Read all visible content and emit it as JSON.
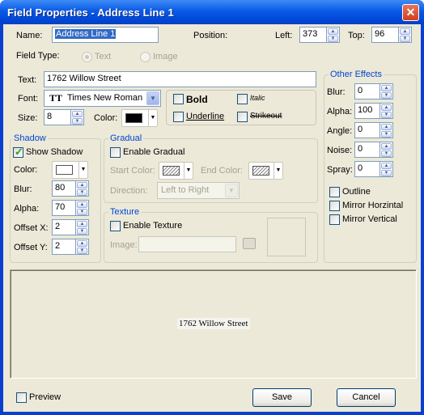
{
  "window": {
    "title": "Field Properties - Address Line 1",
    "close_glyph": "✕"
  },
  "fields": {
    "name_label": "Name:",
    "name_value": "Address Line 1",
    "position_label": "Position:",
    "left_label": "Left:",
    "left_value": "373",
    "top_label": "Top:",
    "top_value": "96",
    "field_type_label": "Field Type:",
    "type_text": "Text",
    "type_image": "Image",
    "text_label": "Text:",
    "text_value": "1762 Willow Street",
    "font_label": "Font:",
    "font_value": "Times New Roman",
    "font_icon": "TT",
    "size_label": "Size:",
    "size_value": "8",
    "color_label": "Color:",
    "color_value": "#000000",
    "bold": "Bold",
    "italic": "Italic",
    "underline": "Underline",
    "strikeout": "Strikeout"
  },
  "shadow": {
    "title": "Shadow",
    "show_label": "Show Shadow",
    "show_checked": true,
    "color_label": "Color:",
    "color_value": "#ffffff",
    "blur_label": "Blur:",
    "blur_value": "80",
    "alpha_label": "Alpha:",
    "alpha_value": "70",
    "offx_label": "Offset X:",
    "offx_value": "2",
    "offy_label": "Offset Y:",
    "offy_value": "2"
  },
  "gradual": {
    "title": "Gradual",
    "enable_label": "Enable Gradual",
    "start_label": "Start Color:",
    "end_label": "End Color:",
    "direction_label": "Direction:",
    "direction_value": "Left to Right"
  },
  "texture": {
    "title": "Texture",
    "enable_label": "Enable Texture",
    "image_label": "Image:"
  },
  "effects": {
    "title": "Other Effects",
    "blur_label": "Blur:",
    "blur_value": "0",
    "alpha_label": "Alpha:",
    "alpha_value": "100",
    "angle_label": "Angle:",
    "angle_value": "0",
    "noise_label": "Noise:",
    "noise_value": "0",
    "spray_label": "Spray:",
    "spray_value": "0",
    "outline": "Outline",
    "mirror_h": "Mirror Horzintal",
    "mirror_v": "Mirror Vertical"
  },
  "preview": {
    "text": "1762 Willow Street",
    "checkbox_label": "Preview"
  },
  "buttons": {
    "save": "Save",
    "cancel": "Cancel"
  }
}
